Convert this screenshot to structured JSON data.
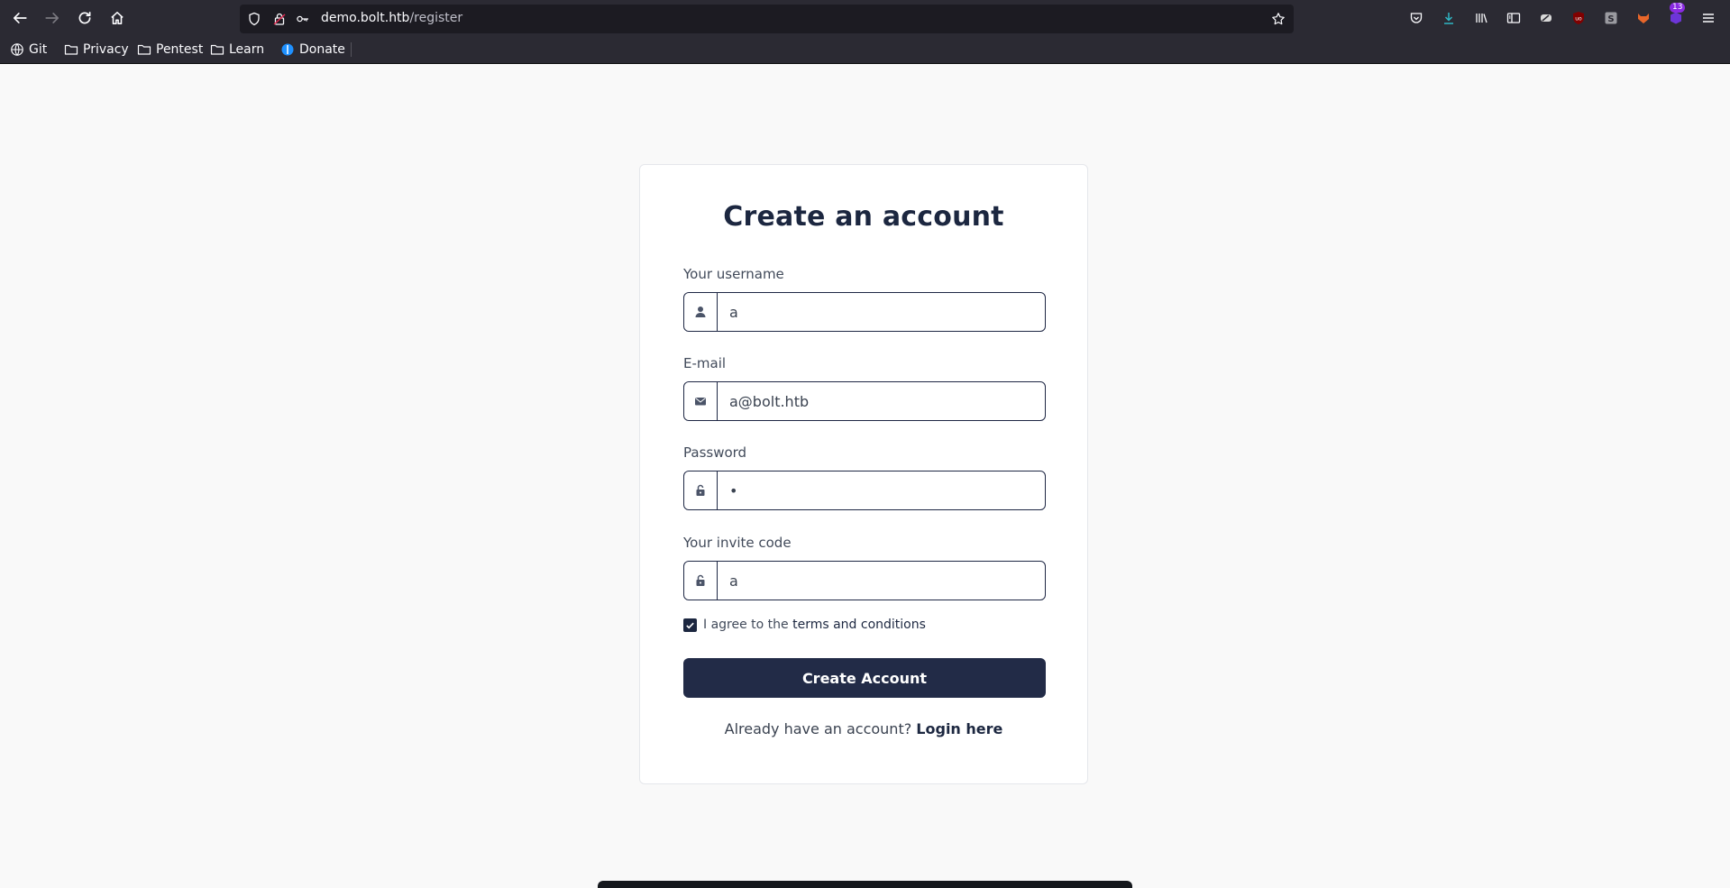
{
  "browser": {
    "url_host": "demo.bolt.htb",
    "url_path": "/register",
    "extension_badge": "13",
    "bookmarks": [
      "Git",
      "Privacy",
      "Pentest",
      "Learn",
      "Donate"
    ]
  },
  "form": {
    "title": "Create an account",
    "username_label": "Your username",
    "username_value": "a",
    "email_label": "E-mail",
    "email_value": "a@bolt.htb",
    "password_label": "Password",
    "password_value": "a",
    "invite_label": "Your invite code",
    "invite_value": "a",
    "agree_prefix": "I agree to the ",
    "agree_link": "terms and conditions",
    "agree_checked": true,
    "submit_label": "Create Account",
    "login_prefix": "Already have an account? ",
    "login_link": "Login here"
  },
  "colors": {
    "primary": "#222b47",
    "page_bg": "#f9f9f9",
    "chrome_bg": "#2b2a33"
  }
}
